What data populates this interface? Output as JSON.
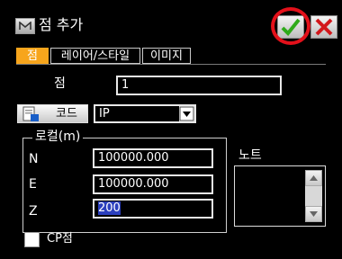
{
  "window": {
    "title": "점 추가",
    "ok_icon": "checkmark-icon",
    "close_icon": "close-x-icon",
    "accent_color": "#f7a51c",
    "ok_color": "#2faa1a",
    "close_color": "#d3171b",
    "highlight_color": "#e3101a"
  },
  "tabs": [
    {
      "label": "점",
      "active": true
    },
    {
      "label": "레이어/스타일",
      "active": false
    },
    {
      "label": "이미지",
      "active": false
    }
  ],
  "point": {
    "label": "점",
    "value": "1"
  },
  "code": {
    "button_label": "코드",
    "selected": "IP"
  },
  "local": {
    "group_label": "로컬(m)",
    "n_label": "N",
    "n_value": "100000.000",
    "e_label": "E",
    "e_value": "100000.000",
    "z_label": "Z",
    "z_value": "200"
  },
  "note": {
    "label": "노트"
  },
  "cp": {
    "label": "CP점",
    "checked": false
  }
}
